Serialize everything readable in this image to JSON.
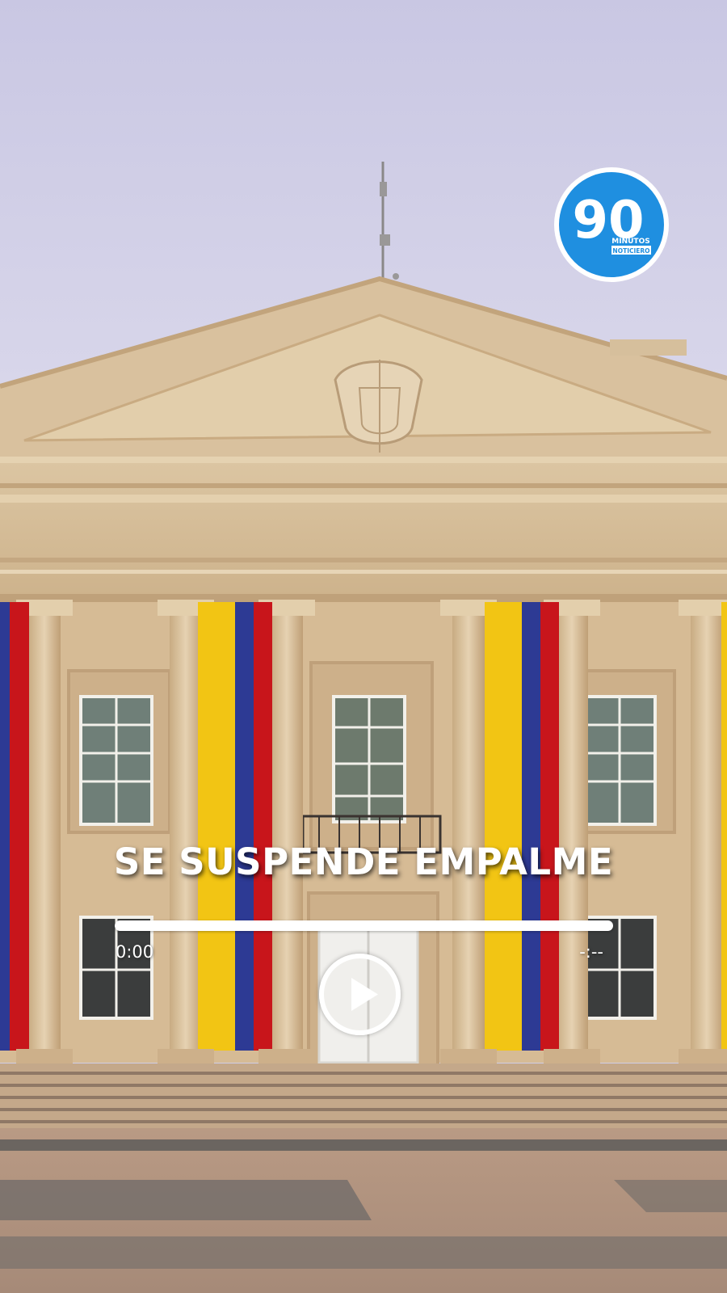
{
  "video": {
    "headline": "SE SUSPENDE EMPALME",
    "current_time": "0:00",
    "total_time": "-:--",
    "progress": 0
  },
  "logo": {
    "number": "90",
    "line1": "MINUTOS",
    "line2": "NOTICIERO",
    "color": "#1f8fe0"
  },
  "icons": {
    "play": "play-icon"
  },
  "colors": {
    "flag_yellow": "#f2c514",
    "flag_blue": "#2d3a94",
    "flag_red": "#c8151b",
    "sky": "#cfcde6",
    "stone": "#d8c1a0"
  }
}
